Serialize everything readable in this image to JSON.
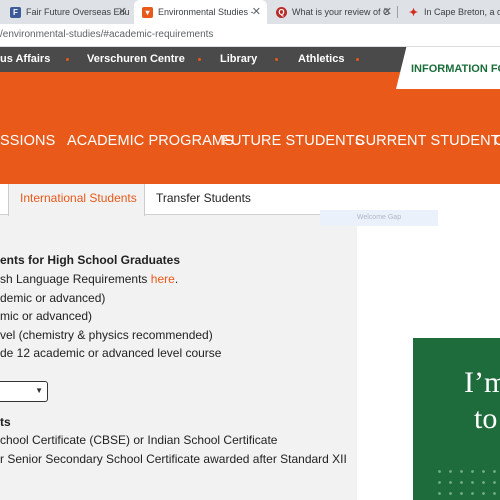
{
  "browser": {
    "tabs": [
      {
        "title": "Fair Future Overseas Edu",
        "favicon": "FF",
        "active": false
      },
      {
        "title": "Environmental Studies -",
        "favicon": "A",
        "active": true
      },
      {
        "title": "What is your review of C",
        "favicon": "Q",
        "active": false
      },
      {
        "title": "In Cape Breton, a d",
        "favicon": "maple-leaf-icon",
        "active": false
      }
    ],
    "url": "/environmental-studies/#academic-requirements"
  },
  "utility_nav": [
    "us Affairs",
    "Verschuren Centre",
    "Library",
    "Athletics"
  ],
  "info_label": "INFORMATION FOR",
  "main_nav": [
    "SSIONS",
    "ACADEMIC PROGRAMS",
    "FUTURE STUDENTS",
    "CURRENT STUDENTS",
    "C"
  ],
  "subtabs": {
    "international": "International  Students",
    "transfer": "Transfer  Students"
  },
  "content": {
    "heading": "ents for High School Graduates",
    "english_line": "sh Language Requirements ",
    "english_link": "here",
    "english_after": ".",
    "line2": "demic or advanced)",
    "line3": "mic or advanced)",
    "line4": "vel (chemistry & physics recommended)",
    "line5": "de 12 academic or advanced level course",
    "section2_heading": "ts",
    "line6": "chool Certificate (CBSE) or Indian School Certificate",
    "line7": "r Senior Secondary School Certificate awarded after Standard XII"
  },
  "ghost_text": "Welcome Gap",
  "promo": {
    "line1": "I’m",
    "line2": "to"
  },
  "colors": {
    "accent": "#e8591a",
    "green": "#1e6b3b",
    "util_bar": "#4a4a4a"
  }
}
